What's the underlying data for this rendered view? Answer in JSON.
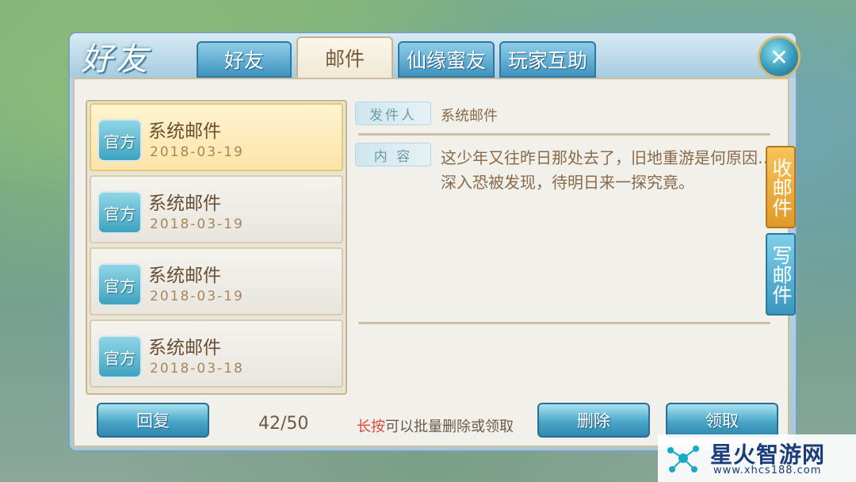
{
  "header": {
    "logo_text": "好友",
    "tabs": [
      {
        "label": "好友",
        "active": false
      },
      {
        "label": "邮件",
        "active": true
      },
      {
        "label": "仙缘蜜友",
        "active": false
      },
      {
        "label": "玩家互助",
        "active": false
      }
    ],
    "close_icon": "close-icon"
  },
  "mail_list": [
    {
      "badge": "官方",
      "title": "系统邮件",
      "date": "2018-03-19",
      "selected": true
    },
    {
      "badge": "官方",
      "title": "系统邮件",
      "date": "2018-03-19",
      "selected": false
    },
    {
      "badge": "官方",
      "title": "系统邮件",
      "date": "2018-03-19",
      "selected": false
    },
    {
      "badge": "官方",
      "title": "系统邮件",
      "date": "2018-03-18",
      "selected": false
    }
  ],
  "detail": {
    "sender_label": "发件人",
    "sender_value": "系统邮件",
    "content_label": "内 容",
    "content_text": "这少年又往昨日那处去了，旧地重游是何原因……深入恐被发现，待明日来一探究竟。"
  },
  "side_tabs": {
    "inbox": "收邮件",
    "compose": "写邮件"
  },
  "footer": {
    "reply_label": "回复",
    "count": "42/50",
    "hint_emphasis": "长按",
    "hint_rest": "可以批量删除或领取",
    "delete_label": "删除",
    "claim_label": "领取"
  },
  "watermark": {
    "name": "星火智游网",
    "url": "www.xhcs188.com"
  },
  "colors": {
    "accent_blue": "#3f93bf",
    "accent_gold": "#e09a2a",
    "text_brown": "#8a6a4a",
    "hint_red": "#d94a3a"
  }
}
